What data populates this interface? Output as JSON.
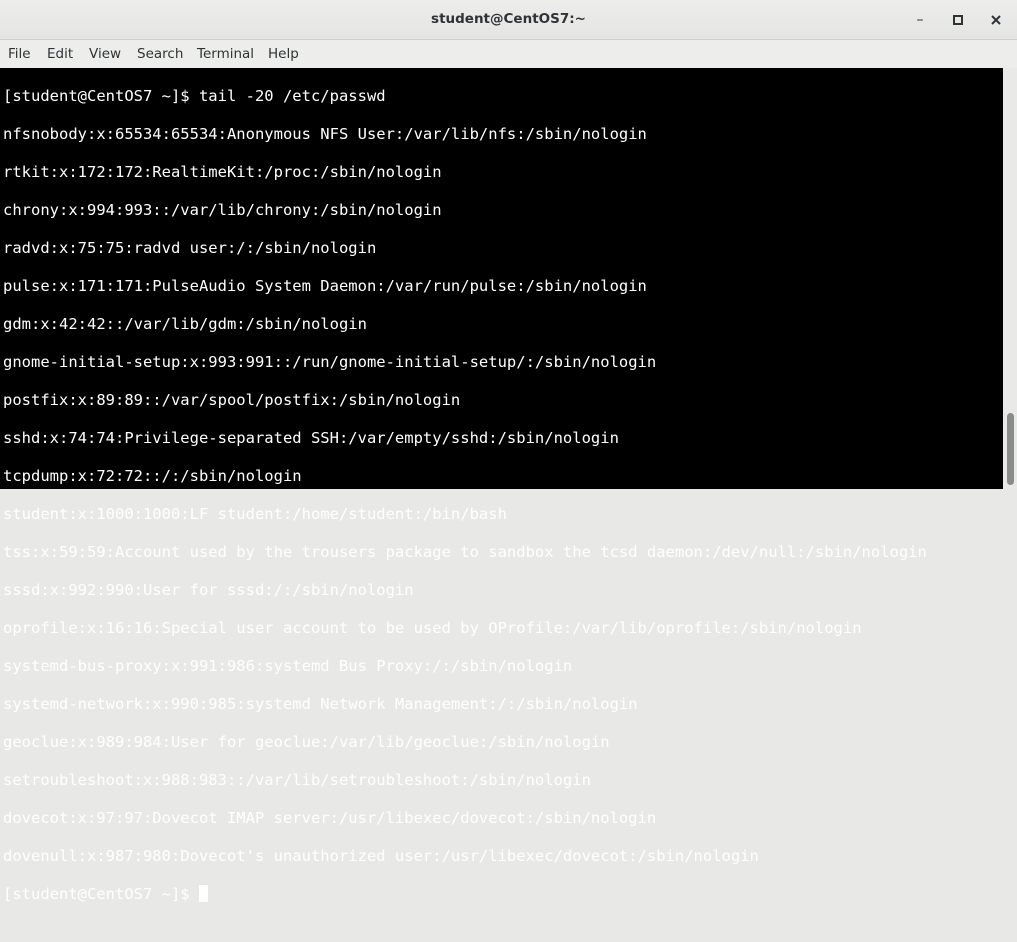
{
  "window": {
    "title": "student@CentOS7:~"
  },
  "menubar": [
    "File",
    "Edit",
    "View",
    "Search",
    "Terminal",
    "Help"
  ],
  "terminal": {
    "lines": [
      "[student@CentOS7 ~]$ tail -20 /etc/passwd",
      "nfsnobody:x:65534:65534:Anonymous NFS User:/var/lib/nfs:/sbin/nologin",
      "rtkit:x:172:172:RealtimeKit:/proc:/sbin/nologin",
      "chrony:x:994:993::/var/lib/chrony:/sbin/nologin",
      "radvd:x:75:75:radvd user:/:/sbin/nologin",
      "pulse:x:171:171:PulseAudio System Daemon:/var/run/pulse:/sbin/nologin",
      "gdm:x:42:42::/var/lib/gdm:/sbin/nologin",
      "gnome-initial-setup:x:993:991::/run/gnome-initial-setup/:/sbin/nologin",
      "postfix:x:89:89::/var/spool/postfix:/sbin/nologin",
      "sshd:x:74:74:Privilege-separated SSH:/var/empty/sshd:/sbin/nologin",
      "tcpdump:x:72:72::/:/sbin/nologin",
      "student:x:1000:1000:LF student:/home/student:/bin/bash",
      "tss:x:59:59:Account used by the trousers package to sandbox the tcsd daemon:/dev/null:/sbin/nologin",
      "sssd:x:992:990:User for sssd:/:/sbin/nologin",
      "oprofile:x:16:16:Special user account to be used by OProfile:/var/lib/oprofile:/sbin/nologin",
      "systemd-bus-proxy:x:991:986:systemd Bus Proxy:/:/sbin/nologin",
      "systemd-network:x:990:985:systemd Network Management:/:/sbin/nologin",
      "geoclue:x:989:984:User for geoclue:/var/lib/geoclue:/sbin/nologin",
      "setroubleshoot:x:988:983::/var/lib/setroubleshoot:/sbin/nologin",
      "dovecot:x:97:97:Dovecot IMAP server:/usr/libexec/dovecot:/sbin/nologin",
      "dovenull:x:987:980:Dovecot's unauthorized user:/usr/libexec/dovecot:/sbin/nologin"
    ],
    "prompt": "[student@CentOS7 ~]$ "
  }
}
